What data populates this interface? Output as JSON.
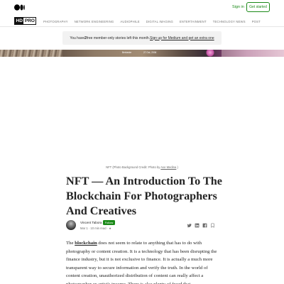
{
  "header": {
    "signin_label": "Sign in",
    "getstarted_label": "Get started"
  },
  "publication": {
    "logo_left": "HD",
    "logo_right": "PRO",
    "nav": [
      "PHOTOGRAPHY",
      "NETWORK ENGINEERING",
      "AUDIOPHILE",
      "DIGITAL IMAGING",
      "ENTERTAINMENT",
      "TECHNOLOGY NEWS",
      "POST"
    ]
  },
  "banner": {
    "prefix": "You have ",
    "count": "2",
    "middle": " free member-only stories left this month. ",
    "link": "Sign up for Medium and get an extra one"
  },
  "hero": {
    "tag1": "Belvieder",
    "tag2": "27 Oct, 2006"
  },
  "caption": {
    "text": "NFT (Photo Background Credit: Photo by ",
    "link": "Ave Medina",
    "suffix": " )"
  },
  "article": {
    "title": "NFT — An Introduction To The Blockchain For Photographers And Creatives",
    "author": "Vincent Tabora",
    "follow_label": "Follow",
    "meta": "Mar 1 · 10 min read · ★",
    "body_keyword": "blockchain",
    "body_pre": "The ",
    "body_post": " does not seem to relate to anything that has to do with photography or content creation. It is a technology that has been disrupting the finance industry, but it is not exclusive to finance. It is actually a much more transparent way to secure information and verify the truth. In the world of content creation, unauthorized distribution of content can really affect a photographer or artist's income. There is also plenty of fraud that"
  },
  "icons": {
    "brand": "medium-logo-icon",
    "share": [
      "twitter-icon",
      "linkedin-icon",
      "facebook-icon",
      "bookmark-icon"
    ]
  },
  "colors": {
    "accent": "#1a8917",
    "banner_bg": "#f2f2f2"
  }
}
